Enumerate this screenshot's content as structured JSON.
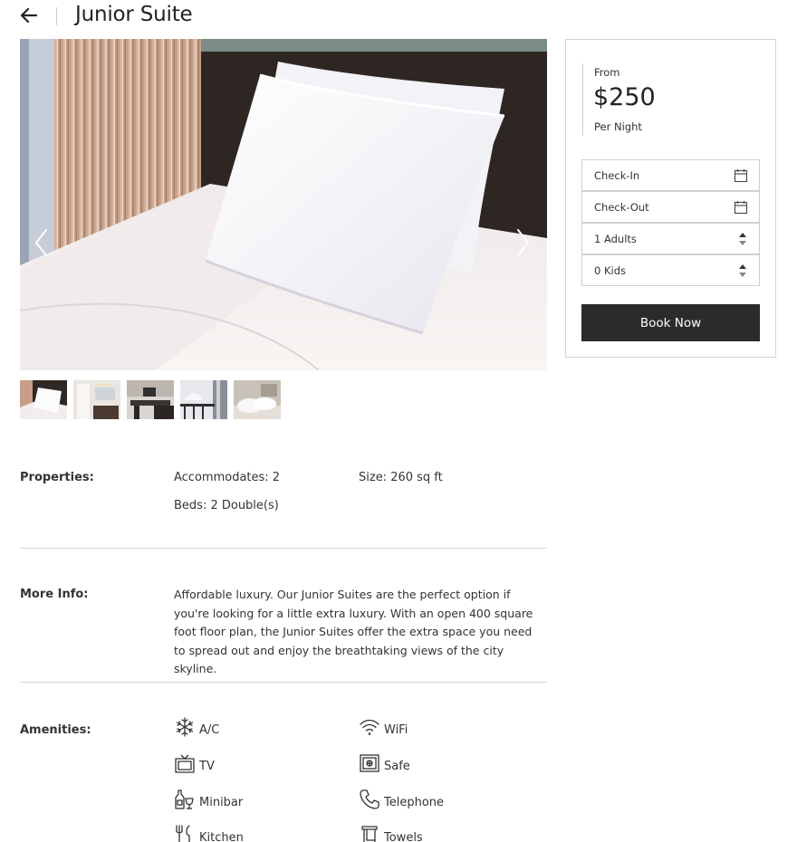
{
  "header": {
    "title": "Junior Suite",
    "back_icon": "arrow-left-icon"
  },
  "gallery": {
    "prev_icon": "chevron-left-icon",
    "next_icon": "chevron-right-icon",
    "thumbnail_count": 5
  },
  "booking": {
    "from_label": "From",
    "price": "$250",
    "per_night_label": "Per Night",
    "check_in": "Check-In",
    "check_out": "Check-Out",
    "adults": "1 Adults",
    "kids": "0 Kids",
    "book_button": "Book Now",
    "button_color": "#2b2b2b"
  },
  "properties": {
    "label": "Properties:",
    "accommodates": "Accommodates: 2",
    "size": "Size: 260 sq ft",
    "beds": "Beds: 2 Double(s)"
  },
  "more_info": {
    "label": "More Info:",
    "text": "Affordable luxury. Our Junior Suites are the perfect option if you're looking for a little extra luxury. With an open 400 square foot floor plan, the Junior Suites offer the extra space you need to spread out and enjoy the breathtaking views of the city skyline."
  },
  "amenities": {
    "label": "Amenities:",
    "items": [
      {
        "label": "A/C",
        "icon": "snowflake-icon"
      },
      {
        "label": "WiFi",
        "icon": "wifi-icon"
      },
      {
        "label": "TV",
        "icon": "tv-icon"
      },
      {
        "label": "Safe",
        "icon": "safe-icon"
      },
      {
        "label": "Minibar",
        "icon": "minibar-icon"
      },
      {
        "label": "Telephone",
        "icon": "telephone-icon"
      },
      {
        "label": "Kitchen",
        "icon": "kitchen-icon"
      },
      {
        "label": "Towels",
        "icon": "towels-icon"
      }
    ]
  }
}
